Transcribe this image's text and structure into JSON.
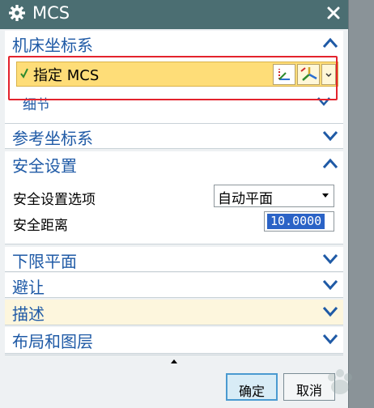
{
  "dialog": {
    "title": "MCS",
    "close_icon": "close-icon",
    "settings_icon": "gear-icon"
  },
  "sections": {
    "machine_csys": {
      "title": "机床坐标系",
      "expanded": true,
      "specify_mcs_label": "指定 MCS",
      "details_label": "细节"
    },
    "reference_csys": {
      "title": "参考坐标系",
      "expanded": false
    },
    "safety": {
      "title": "安全设置",
      "expanded": true,
      "option_label": "安全设置选项",
      "option_value": "自动平面",
      "distance_label": "安全距离",
      "distance_value": "10.0000"
    },
    "lower_plane": {
      "title": "下限平面",
      "expanded": false
    },
    "avoidance": {
      "title": "避让",
      "expanded": false
    },
    "description": {
      "title": "描述",
      "expanded": false
    },
    "layout_layers": {
      "title": "布局和图层",
      "expanded": false
    }
  },
  "footer": {
    "ok_label": "确定",
    "cancel_label": "取消"
  },
  "colors": {
    "titlebar": "#4b6e72",
    "section_title": "#1f5aa6",
    "selected_row": "#fedd78",
    "highlight_box": "#e3232d"
  }
}
